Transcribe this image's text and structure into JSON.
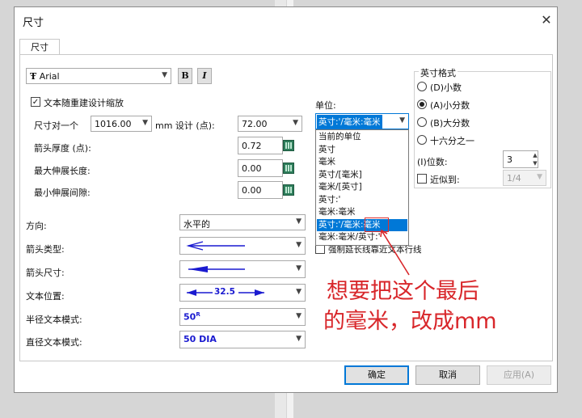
{
  "dialog": {
    "title": "尺寸",
    "tab": "尺寸",
    "font_value": "Arial",
    "font_icon": "Ŧ",
    "bold_label": "B",
    "italic_label": "I",
    "scale_checkbox_label": "文本随重建设计缩放",
    "size_label": "尺寸对一个",
    "size_value": "1016.00",
    "mm_design_label": "mm 设计 (点):",
    "design_value": "72.00",
    "arrow_thickness_label": "箭头厚度 (点):",
    "arrow_thickness_value": "0.72",
    "max_ext_len_label": "最大伸展长度:",
    "max_ext_len_value": "0.00",
    "min_ext_gap_label": "最小伸展间隙:",
    "min_ext_gap_value": "0.00",
    "unit_label": "单位:",
    "unit_value": "英寸:'/毫米:毫米",
    "unit_options": [
      "当前的单位",
      "英寸",
      "毫米",
      "英寸/[毫米]",
      "毫米/[英寸]",
      "英寸:'",
      "毫米:毫米",
      "英寸:'/毫米:毫米",
      "毫米:毫米/英寸:'"
    ],
    "unit_selected_index": 7,
    "force_line_label": "强制延长线靠近文本行线",
    "format_group_title": "英寸格式",
    "format_options": [
      "(D)小数",
      "(A)小分数",
      "(B)大分数",
      "十六分之一"
    ],
    "format_selected_index": 1,
    "digits_label": "(I)位数:",
    "digits_value": "3",
    "round_label": "近似到:",
    "round_value": "1/4",
    "direction_label": "方向:",
    "direction_value": "水平的",
    "arrow_type_label": "箭头类型:",
    "arrow_size_label": "箭头尺寸:",
    "text_pos_label": "文本位置:",
    "text_pos_sample": "32.5",
    "radius_mode_label": "半径文本模式:",
    "radius_mode_value": "50",
    "radius_sup": "R",
    "diameter_mode_label": "直径文本模式:",
    "diameter_mode_value": "50 DIA",
    "ok_label": "确定",
    "cancel_label": "取消",
    "apply_label": "应用(A)",
    "close_glyph": "✕"
  },
  "annotation": {
    "line1": "想要把这个最后",
    "line2": "的毫米，改成mm"
  },
  "colors": {
    "accent": "#0078d7",
    "annotation_red": "#d8262a",
    "arrow_blue": "#1a1ad0"
  }
}
